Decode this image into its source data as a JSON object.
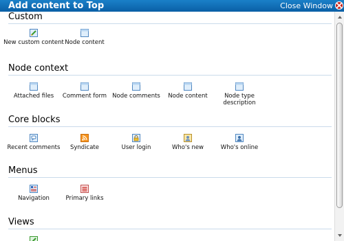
{
  "dialog": {
    "title": "Add content to Top",
    "close_label": "Close Window"
  },
  "sections": [
    {
      "title": "Custom",
      "items": [
        {
          "label": "New custom content",
          "icon": "edit-document-icon"
        },
        {
          "label": "Node content",
          "icon": "document-icon"
        }
      ]
    },
    {
      "title": "Node context",
      "items": [
        {
          "label": "Attached files",
          "icon": "document-icon"
        },
        {
          "label": "Comment form",
          "icon": "document-icon"
        },
        {
          "label": "Node comments",
          "icon": "document-icon"
        },
        {
          "label": "Node content",
          "icon": "document-icon"
        },
        {
          "label": "Node type description",
          "icon": "document-icon"
        }
      ]
    },
    {
      "title": "Core blocks",
      "items": [
        {
          "label": "Recent comments",
          "icon": "comment-icon"
        },
        {
          "label": "Syndicate",
          "icon": "rss-feed-icon"
        },
        {
          "label": "User login",
          "icon": "lock-icon"
        },
        {
          "label": "Who's new",
          "icon": "user-new-icon"
        },
        {
          "label": "Who's online",
          "icon": "user-online-icon"
        }
      ]
    },
    {
      "title": "Menus",
      "items": [
        {
          "label": "Navigation",
          "icon": "navigation-menu-icon"
        },
        {
          "label": "Primary links",
          "icon": "primary-links-icon"
        }
      ]
    },
    {
      "title": "Views",
      "items": [
        {
          "label": "",
          "icon": "view-icon"
        }
      ]
    }
  ],
  "colors": {
    "titlebar": "#0a6fb8",
    "close_button": "#c8231c",
    "section_rule": "#c9daea"
  }
}
